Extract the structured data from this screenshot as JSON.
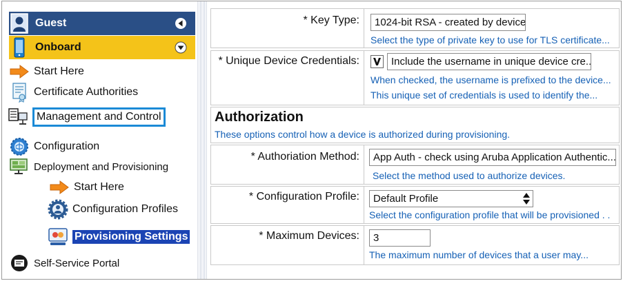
{
  "sidebar": {
    "guest_label": "Guest",
    "onboard_label": "Onboard",
    "items": {
      "start_here": "Start Here",
      "certificate_authorities": "Certificate Authorities",
      "management_and_control": "Management and Control",
      "configuration": "Configuration",
      "deployment_and_provisioning": "Deployment and Provisioning",
      "sub_start_here": "Start Here",
      "configuration_profiles": "Configuration Profiles",
      "provisioning_settings": "Provisioning Settings",
      "self_service_portal": "Self-Service Portal"
    }
  },
  "form": {
    "key_type": {
      "label": "* Key Type:",
      "value": "1024-bit RSA - created by device",
      "hint": "Select the type of private key to use for TLS certificate..."
    },
    "unique_credentials": {
      "label": "* Unique Device Credentials:",
      "checkbox_text": "Include the username in unique device cre...",
      "checked": true,
      "hint1": "When checked, the username is prefixed to the device...",
      "hint2": "This unique set of credentials is used to identify the..."
    },
    "authorization": {
      "title": "Authorization",
      "description": "These options control how a device is authorized during provisioning."
    },
    "auth_method": {
      "label": "* Authoriation Method:",
      "value": "App Auth - check using Aruba Application Authentic...",
      "hint": "Select the method used to authorize devices."
    },
    "config_profile": {
      "label": "* Configuration Profile:",
      "value": "Default Profile",
      "hint": "Select the configuration profile that will be provisioned . ."
    },
    "max_devices": {
      "label": "* Maximum Devices:",
      "value": "3",
      "hint": "The maximum number of devices that a user may..."
    }
  },
  "colors": {
    "guest_bar": "#2a4f86",
    "onboard_bar": "#f4c319",
    "selected_item": "#1b44b4",
    "focus_outline": "#1b8ad6",
    "hint_text": "#1560b5"
  },
  "icons": {
    "guest": "guest-user-icon",
    "onboard": "onboard-phone-icon",
    "start_here": "arrow-right-icon",
    "certificate_authorities": "certificate-icon",
    "management_and_control": "management-icon",
    "configuration": "gear-globe-icon",
    "deployment": "deployment-monitor-icon",
    "configuration_profiles": "gear-user-icon",
    "provisioning_settings": "provisioning-icon",
    "self_service_portal": "portal-icon"
  }
}
